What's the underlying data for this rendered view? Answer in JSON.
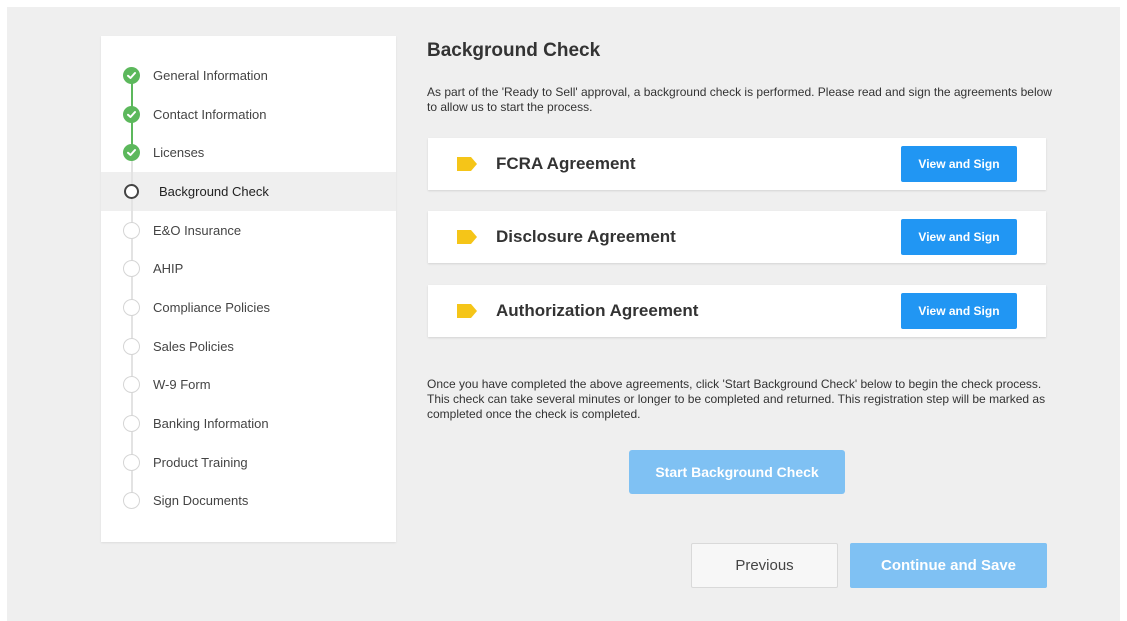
{
  "colors": {
    "done": "#5cb85c",
    "accent": "#2196f3",
    "accent_disabled": "#7fc1f3",
    "tag": "#f5c518",
    "background": "#efefef"
  },
  "sidebar": {
    "steps": [
      {
        "label": "General Information",
        "status": "done",
        "icon": "check-circle-icon"
      },
      {
        "label": "Contact Information",
        "status": "done",
        "icon": "check-circle-icon"
      },
      {
        "label": "Licenses",
        "status": "done",
        "icon": "check-circle-icon"
      },
      {
        "label": "Background Check",
        "status": "current",
        "icon": "circle-outline-icon"
      },
      {
        "label": "E&O Insurance",
        "status": "todo",
        "icon": "circle-outline-icon"
      },
      {
        "label": "AHIP",
        "status": "todo",
        "icon": "circle-outline-icon"
      },
      {
        "label": "Compliance Policies",
        "status": "todo",
        "icon": "circle-outline-icon"
      },
      {
        "label": "Sales Policies",
        "status": "todo",
        "icon": "circle-outline-icon"
      },
      {
        "label": "W-9 Form",
        "status": "todo",
        "icon": "circle-outline-icon"
      },
      {
        "label": "Banking Information",
        "status": "todo",
        "icon": "circle-outline-icon"
      },
      {
        "label": "Product Training",
        "status": "todo",
        "icon": "circle-outline-icon"
      },
      {
        "label": "Sign Documents",
        "status": "todo",
        "icon": "circle-outline-icon"
      }
    ]
  },
  "main": {
    "title": "Background Check",
    "intro": "As part of the 'Ready to Sell' approval, a background check is performed. Please read and sign the agreements below to allow us to start the process.",
    "agreements": [
      {
        "label": "FCRA Agreement",
        "button": "View and Sign",
        "icon": "tag-icon"
      },
      {
        "label": "Disclosure Agreement",
        "button": "View and Sign",
        "icon": "tag-icon"
      },
      {
        "label": "Authorization Agreement",
        "button": "View and Sign",
        "icon": "tag-icon"
      }
    ],
    "note": "Once you have completed the above agreements, click 'Start Background Check' below to begin the check process. This check can take several minutes or longer to be completed and returned. This registration step will be marked as completed once the check is completed.",
    "start_button": "Start Background Check"
  },
  "footer": {
    "previous": "Previous",
    "continue": "Continue and Save"
  }
}
